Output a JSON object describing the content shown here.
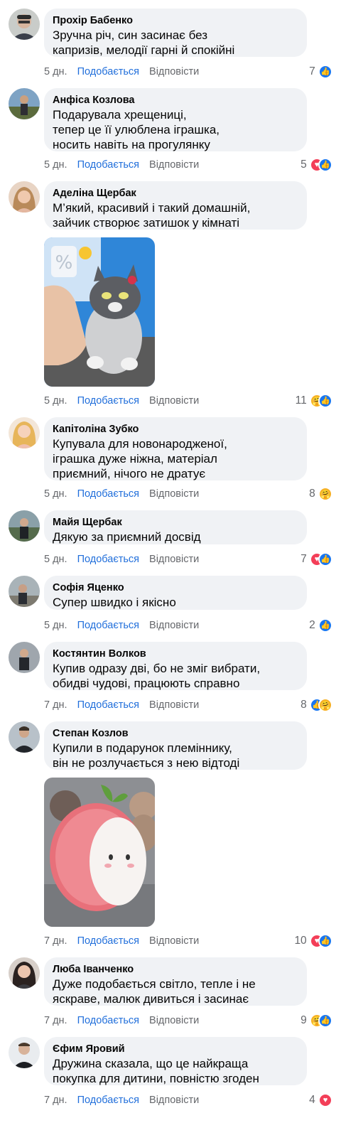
{
  "labels": {
    "like": "Подобається",
    "reply": "Відповісти"
  },
  "comments": [
    {
      "author": "Прохір Бабенко",
      "text": "Зручна річ, син засинає без\nкапризів, мелодії гарні й спокійні",
      "time": "5 дн.",
      "count": "7",
      "reactions": [
        "like"
      ]
    },
    {
      "author": "Анфіса Козлова",
      "text": "Подарувала хрещениці,\nтепер це її улюблена іграшка,\nносить навіть на прогулянку",
      "time": "5 дн.",
      "count": "5",
      "reactions": [
        "love",
        "like"
      ]
    },
    {
      "author": "Аделіна Щербак",
      "text": "М’який, красивий і такий домашній,\nзайчик створює затишок у кімнаті",
      "time": "5 дн.",
      "count": "11",
      "reactions": [
        "care",
        "like"
      ],
      "photo": "plush-cat-photo"
    },
    {
      "author": "Капітоліна Зубко",
      "text": "Купувала для новонародженої,\nіграшка дуже ніжна, матеріал\nприємний, нічого не дратує",
      "time": "5 дн.",
      "count": "8",
      "reactions": [
        "care"
      ]
    },
    {
      "author": "Майя Щербак",
      "text": "Дякую за приємний досвід",
      "time": "5 дн.",
      "count": "7",
      "reactions": [
        "love",
        "like"
      ]
    },
    {
      "author": "Софія Яценко",
      "text": "Супер швидко і якісно",
      "time": "5 дн.",
      "count": "2",
      "reactions": [
        "like"
      ]
    },
    {
      "author": "Костянтин Волков",
      "text": "Купив одразу дві, бо не зміг вибрати,\nобидві чудові, працюють справно",
      "time": "7 дн.",
      "count": "8",
      "reactions": [
        "like",
        "care"
      ]
    },
    {
      "author": "Степан Козлов",
      "text": "Купили в подарунок племіннику,\nвін не розлучається з нею відтоді",
      "time": "7 дн.",
      "count": "10",
      "reactions": [
        "love",
        "like"
      ],
      "photo": "strawberry-bunny-photo"
    },
    {
      "author": "Люба Іванченко",
      "text": "Дуже подобається світло, тепле і не\nяскраве, малюк дивиться і засинає",
      "time": "7 дн.",
      "count": "9",
      "reactions": [
        "care",
        "like"
      ]
    },
    {
      "author": "Єфим Яровий",
      "text": "Дружина сказала, що це найкраща\nпокупка для дитини, повністю згоден",
      "time": "7 дн.",
      "count": "4",
      "reactions": [
        "love"
      ]
    }
  ]
}
